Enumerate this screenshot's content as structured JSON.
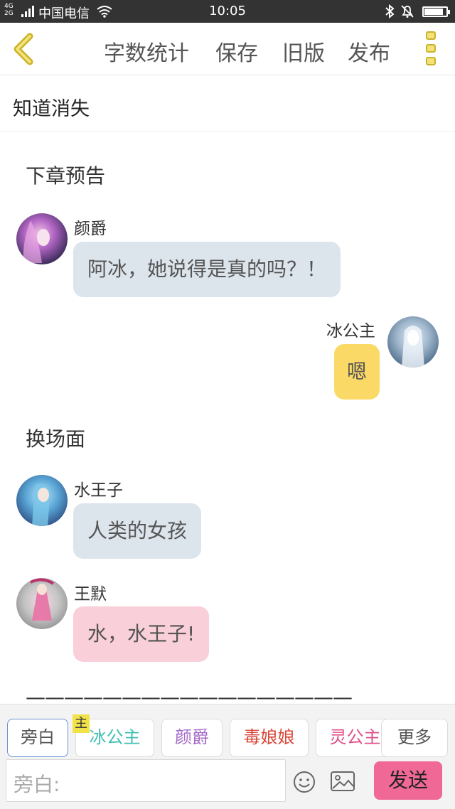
{
  "status_bar": {
    "network": "4G\n2G",
    "carrier": "中国电信",
    "time": "10:05",
    "battery_level": 0.85
  },
  "toolbar": {
    "word_count": "字数统计",
    "save": "保存",
    "old_version": "旧版",
    "publish": "发布"
  },
  "chapter_title": "知道消失",
  "messages": [
    {
      "type": "narration",
      "text": "下章预告"
    },
    {
      "type": "left",
      "speaker": "颜爵",
      "text": "阿冰，她说得是真的吗？！",
      "bubble_color": "#dce4ec"
    },
    {
      "type": "right",
      "speaker": "冰公主",
      "text": "嗯",
      "bubble_color": "#fbd966"
    },
    {
      "type": "narration",
      "text": "换场面"
    },
    {
      "type": "left",
      "speaker": "水王子",
      "text": "人类的女孩",
      "bubble_color": "#dce4ec"
    },
    {
      "type": "left",
      "speaker": "王默",
      "text": "水，水王子!",
      "bubble_color": "#f9cfd9"
    }
  ],
  "divider": "—————————————————",
  "roles": [
    {
      "label": "旁白",
      "color": "#555555",
      "active": true
    },
    {
      "label": "冰公主",
      "color": "#3fbfb2",
      "main_tag": "主"
    },
    {
      "label": "颜爵",
      "color": "#a36ac8"
    },
    {
      "label": "毒娘娘",
      "color": "#d9483a"
    },
    {
      "label": "灵公主",
      "color": "#e0508a"
    },
    {
      "label": "更多",
      "color": "#555555"
    }
  ],
  "input": {
    "label": "旁白:"
  },
  "send_button": "发送"
}
